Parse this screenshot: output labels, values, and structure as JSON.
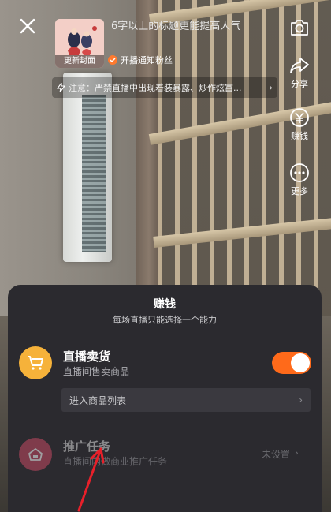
{
  "header": {
    "cover_label": "更新封面",
    "title": "6字以上的标题更能提高人气",
    "notify_fans": "开播通知粉丝",
    "notice": "注意：严禁直播中出现着装暴露、炒作炫富..."
  },
  "tools": {
    "share": "分享",
    "earn": "赚钱",
    "more": "更多"
  },
  "sheet": {
    "title": "赚钱",
    "subtitle": "每场直播只能选择一个能力",
    "sell": {
      "title": "直播卖货",
      "desc": "直播间售卖商品",
      "enabled": true,
      "product_list": "进入商品列表"
    },
    "promo": {
      "title": "推广任务",
      "desc": "直播间内做商业推广任务",
      "status": "未设置"
    }
  },
  "colors": {
    "accent": "#ff6a1a",
    "sell_icon": "#f6b23a",
    "promo_icon": "#c44a63",
    "sheet_bg": "#2b2a2f"
  }
}
